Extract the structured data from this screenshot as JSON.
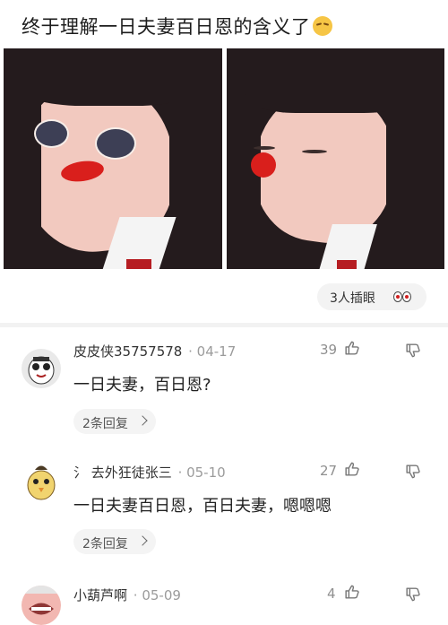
{
  "post": {
    "title": "终于理解一日夫妻百日恩的含义了",
    "emoji_icon": "embarrassed-face-icon",
    "like_pill_text": "3人插眼"
  },
  "comments": [
    {
      "username": "皮皮侠35757578",
      "date": "· 04-17",
      "likes": "39",
      "text": "一日夫妻，百日恩?",
      "replies": "2条回复"
    },
    {
      "username": "氵 去外狂徒张三",
      "date": "· 05-10",
      "likes": "27",
      "text": "一日夫妻百日恩，百日夫妻，嗯嗯嗯",
      "replies": "2条回复"
    },
    {
      "username": "小葫芦啊",
      "date": "· 05-09",
      "likes": "4",
      "text": "",
      "replies": ""
    }
  ]
}
